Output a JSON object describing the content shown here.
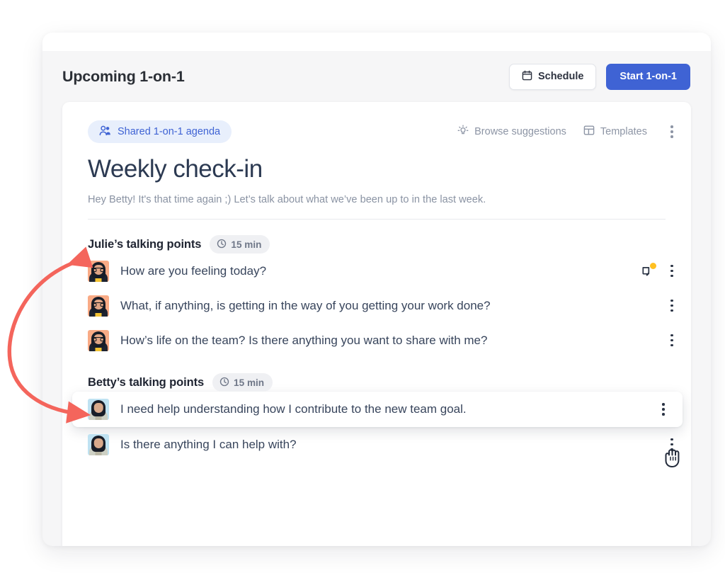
{
  "header": {
    "title": "Upcoming 1-on-1",
    "schedule_button": "Schedule",
    "schedule_icon": "calendar-icon",
    "start_button": "Start 1-on-1"
  },
  "toolbar": {
    "shared_badge": "Shared 1-on-1 agenda",
    "shared_badge_icon": "people-icon",
    "browse_suggestions": "Browse suggestions",
    "browse_suggestions_icon": "lightbulb-icon",
    "templates": "Templates",
    "templates_icon": "layout-icon",
    "more_menu_icon": "kebab-menu-icon"
  },
  "agenda": {
    "title": "Weekly check-in",
    "subtitle": "Hey Betty! It's that time again ;) Let’s talk about what we’ve been up to in the last week."
  },
  "sections": [
    {
      "name": "Julie’s talking points",
      "duration": "15 min",
      "duration_icon": "clock-icon",
      "owner": "julie",
      "points": [
        {
          "text": "How are you feeling today?",
          "has_note": true,
          "note_icon": "note-edit-icon",
          "dragging": false
        },
        {
          "text": "What, if anything, is getting in the way of you getting your work done?",
          "has_note": false,
          "dragging": false
        },
        {
          "text": "How’s life on the team? Is there anything you want to share with me?",
          "has_note": false,
          "dragging": false
        }
      ]
    },
    {
      "name": "Betty’s talking points",
      "duration": "15 min",
      "duration_icon": "clock-icon",
      "owner": "betty",
      "points": [
        {
          "text": "I need help understanding how I contribute to the new team goal.",
          "has_note": false,
          "dragging": true
        },
        {
          "text": "Is there anything I can help with?",
          "has_note": false,
          "dragging": false
        }
      ]
    }
  ],
  "annotation": {
    "arrow_color": "#f4655c",
    "description": "curved double-headed arrow between the two talking-point sections"
  },
  "cursor": {
    "type": "grabbing-hand-cursor"
  },
  "colors": {
    "primary": "#3f63d4",
    "badge_bg": "#e8effc",
    "note_badge": "#ffc021",
    "avatar_julie_bg": "#f9ab86",
    "avatar_betty_bg": "#bfe2f2"
  }
}
